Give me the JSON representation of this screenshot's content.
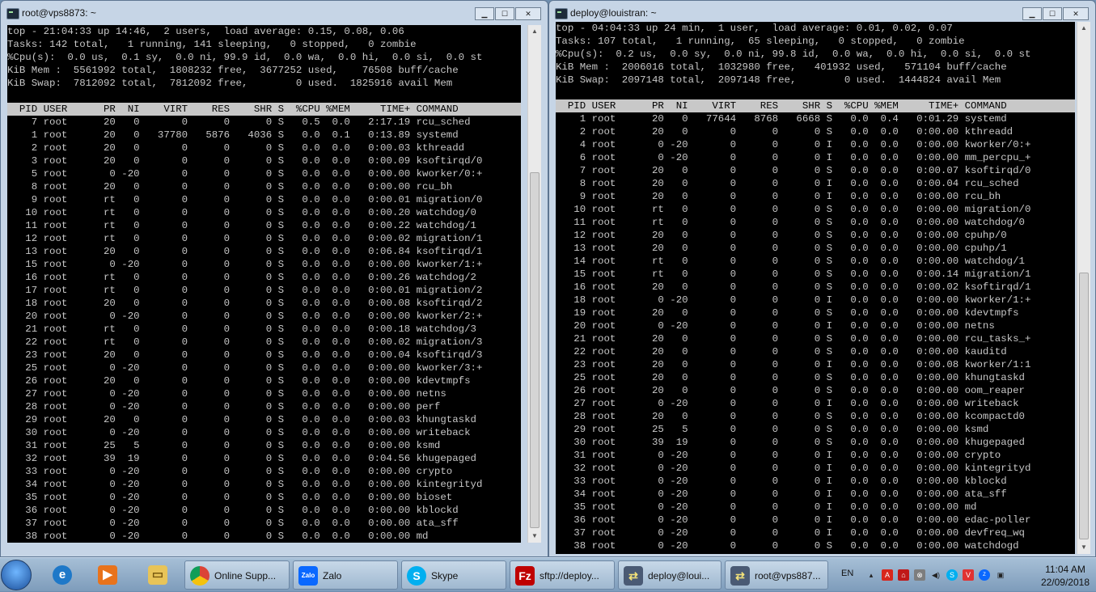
{
  "window_left": {
    "title": "root@vps8873: ~",
    "header": [
      "top - 21:04:33 up 14:46,  2 users,  load average: 0.15, 0.08, 0.06",
      "Tasks: 142 total,   1 running, 141 sleeping,   0 stopped,   0 zombie",
      "%Cpu(s):  0.0 us,  0.1 sy,  0.0 ni, 99.9 id,  0.0 wa,  0.0 hi,  0.0 si,  0.0 st",
      "KiB Mem :  5561992 total,  1808232 free,  3677252 used,    76508 buff/cache",
      "KiB Swap:  7812092 total,  7812092 free,        0 used.  1825916 avail Mem"
    ],
    "column_header": "  PID USER      PR  NI    VIRT    RES    SHR S  %CPU %MEM     TIME+ COMMAND",
    "rows": [
      "    7 root      20   0       0      0      0 S   0.5  0.0   2:17.19 rcu_sched",
      "    1 root      20   0   37780   5876   4036 S   0.0  0.1   0:13.89 systemd",
      "    2 root      20   0       0      0      0 S   0.0  0.0   0:00.03 kthreadd",
      "    3 root      20   0       0      0      0 S   0.0  0.0   0:00.09 ksoftirqd/0",
      "    5 root       0 -20       0      0      0 S   0.0  0.0   0:00.00 kworker/0:+",
      "    8 root      20   0       0      0      0 S   0.0  0.0   0:00.00 rcu_bh",
      "    9 root      rt   0       0      0      0 S   0.0  0.0   0:00.01 migration/0",
      "   10 root      rt   0       0      0      0 S   0.0  0.0   0:00.20 watchdog/0",
      "   11 root      rt   0       0      0      0 S   0.0  0.0   0:00.22 watchdog/1",
      "   12 root      rt   0       0      0      0 S   0.0  0.0   0:00.02 migration/1",
      "   13 root      20   0       0      0      0 S   0.0  0.0   0:06.84 ksoftirqd/1",
      "   15 root       0 -20       0      0      0 S   0.0  0.0   0:00.00 kworker/1:+",
      "   16 root      rt   0       0      0      0 S   0.0  0.0   0:00.26 watchdog/2",
      "   17 root      rt   0       0      0      0 S   0.0  0.0   0:00.01 migration/2",
      "   18 root      20   0       0      0      0 S   0.0  0.0   0:00.08 ksoftirqd/2",
      "   20 root       0 -20       0      0      0 S   0.0  0.0   0:00.00 kworker/2:+",
      "   21 root      rt   0       0      0      0 S   0.0  0.0   0:00.18 watchdog/3",
      "   22 root      rt   0       0      0      0 S   0.0  0.0   0:00.02 migration/3",
      "   23 root      20   0       0      0      0 S   0.0  0.0   0:00.04 ksoftirqd/3",
      "   25 root       0 -20       0      0      0 S   0.0  0.0   0:00.00 kworker/3:+",
      "   26 root      20   0       0      0      0 S   0.0  0.0   0:00.00 kdevtmpfs",
      "   27 root       0 -20       0      0      0 S   0.0  0.0   0:00.00 netns",
      "   28 root       0 -20       0      0      0 S   0.0  0.0   0:00.00 perf",
      "   29 root      20   0       0      0      0 S   0.0  0.0   0:00.03 khungtaskd",
      "   30 root       0 -20       0      0      0 S   0.0  0.0   0:00.00 writeback",
      "   31 root      25   5       0      0      0 S   0.0  0.0   0:00.00 ksmd",
      "   32 root      39  19       0      0      0 S   0.0  0.0   0:04.56 khugepaged",
      "   33 root       0 -20       0      0      0 S   0.0  0.0   0:00.00 crypto",
      "   34 root       0 -20       0      0      0 S   0.0  0.0   0:00.00 kintegrityd",
      "   35 root       0 -20       0      0      0 S   0.0  0.0   0:00.00 bioset",
      "   36 root       0 -20       0      0      0 S   0.0  0.0   0:00.00 kblockd",
      "   37 root       0 -20       0      0      0 S   0.0  0.0   0:00.00 ata_sff",
      "   38 root       0 -20       0      0      0 S   0.0  0.0   0:00.00 md"
    ]
  },
  "window_right": {
    "title": "deploy@louistran: ~",
    "header": [
      "top - 04:04:33 up 24 min,  1 user,  load average: 0.01, 0.02, 0.07",
      "Tasks: 107 total,   1 running,  65 sleeping,   0 stopped,   0 zombie",
      "%Cpu(s):  0.2 us,  0.0 sy,  0.0 ni, 99.8 id,  0.0 wa,  0.0 hi,  0.0 si,  0.0 st",
      "KiB Mem :  2006016 total,  1032980 free,   401932 used,   571104 buff/cache",
      "KiB Swap:  2097148 total,  2097148 free,        0 used.  1444824 avail Mem"
    ],
    "column_header": "  PID USER      PR  NI    VIRT    RES    SHR S  %CPU %MEM     TIME+ COMMAND",
    "rows": [
      "    1 root      20   0   77644   8768   6668 S   0.0  0.4   0:01.29 systemd",
      "    2 root      20   0       0      0      0 S   0.0  0.0   0:00.00 kthreadd",
      "    4 root       0 -20       0      0      0 I   0.0  0.0   0:00.00 kworker/0:+",
      "    6 root       0 -20       0      0      0 I   0.0  0.0   0:00.00 mm_percpu_+",
      "    7 root      20   0       0      0      0 S   0.0  0.0   0:00.07 ksoftirqd/0",
      "    8 root      20   0       0      0      0 I   0.0  0.0   0:00.04 rcu_sched",
      "    9 root      20   0       0      0      0 I   0.0  0.0   0:00.00 rcu_bh",
      "   10 root      rt   0       0      0      0 S   0.0  0.0   0:00.00 migration/0",
      "   11 root      rt   0       0      0      0 S   0.0  0.0   0:00.00 watchdog/0",
      "   12 root      20   0       0      0      0 S   0.0  0.0   0:00.00 cpuhp/0",
      "   13 root      20   0       0      0      0 S   0.0  0.0   0:00.00 cpuhp/1",
      "   14 root      rt   0       0      0      0 S   0.0  0.0   0:00.00 watchdog/1",
      "   15 root      rt   0       0      0      0 S   0.0  0.0   0:00.14 migration/1",
      "   16 root      20   0       0      0      0 S   0.0  0.0   0:00.02 ksoftirqd/1",
      "   18 root       0 -20       0      0      0 I   0.0  0.0   0:00.00 kworker/1:+",
      "   19 root      20   0       0      0      0 S   0.0  0.0   0:00.00 kdevtmpfs",
      "   20 root       0 -20       0      0      0 I   0.0  0.0   0:00.00 netns",
      "   21 root      20   0       0      0      0 S   0.0  0.0   0:00.00 rcu_tasks_+",
      "   22 root      20   0       0      0      0 S   0.0  0.0   0:00.00 kauditd",
      "   23 root      20   0       0      0      0 I   0.0  0.0   0:00.08 kworker/1:1",
      "   25 root      20   0       0      0      0 S   0.0  0.0   0:00.00 khungtaskd",
      "   26 root      20   0       0      0      0 S   0.0  0.0   0:00.00 oom_reaper",
      "   27 root       0 -20       0      0      0 I   0.0  0.0   0:00.00 writeback",
      "   28 root      20   0       0      0      0 S   0.0  0.0   0:00.00 kcompactd0",
      "   29 root      25   5       0      0      0 S   0.0  0.0   0:00.00 ksmd",
      "   30 root      39  19       0      0      0 S   0.0  0.0   0:00.00 khugepaged",
      "   31 root       0 -20       0      0      0 I   0.0  0.0   0:00.00 crypto",
      "   32 root       0 -20       0      0      0 I   0.0  0.0   0:00.00 kintegrityd",
      "   33 root       0 -20       0      0      0 I   0.0  0.0   0:00.00 kblockd",
      "   34 root       0 -20       0      0      0 I   0.0  0.0   0:00.00 ata_sff",
      "   35 root       0 -20       0      0      0 I   0.0  0.0   0:00.00 md",
      "   36 root       0 -20       0      0      0 I   0.0  0.0   0:00.00 edac-poller",
      "   37 root       0 -20       0      0      0 I   0.0  0.0   0:00.00 devfreq_wq",
      "   38 root       0 -20       0      0      0 S   0.0  0.0   0:00.00 watchdogd"
    ]
  },
  "taskbar": {
    "pinned": [
      {
        "icon": "internet-explorer-icon"
      },
      {
        "icon": "media-player-icon"
      },
      {
        "icon": "file-explorer-icon"
      }
    ],
    "tasks": [
      {
        "icon": "chrome-icon",
        "label": "Online Supp..."
      },
      {
        "icon": "zalo-icon",
        "label": "Zalo"
      },
      {
        "icon": "skype-icon",
        "label": "Skype"
      },
      {
        "icon": "filezilla-icon",
        "label": "sftp://deploy..."
      },
      {
        "icon": "putty-icon",
        "label": "deploy@loui..."
      },
      {
        "icon": "putty-icon",
        "label": "root@vps887..."
      }
    ],
    "language": "EN",
    "clock_time": "11:04 AM",
    "clock_date": "22/09/2018"
  }
}
